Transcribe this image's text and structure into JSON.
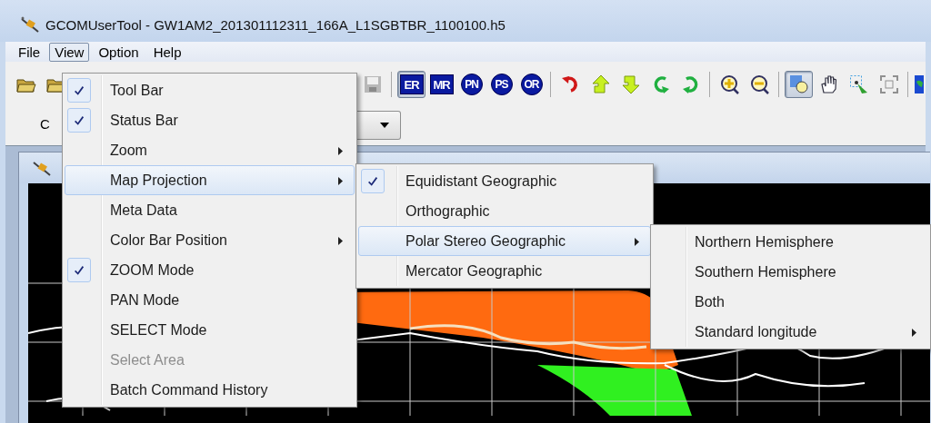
{
  "window": {
    "title": "GCOMUserTool - GW1AM2_201301112311_166A_L1SGBTBR_1100100.h5"
  },
  "menubar": [
    {
      "label": "File",
      "selected": false
    },
    {
      "label": "View",
      "selected": true
    },
    {
      "label": "Option",
      "selected": false
    },
    {
      "label": "Help",
      "selected": false
    }
  ],
  "toolbar_left": [
    {
      "kind": "open-folder",
      "pressed": false
    },
    {
      "kind": "open-folder",
      "pressed": false
    }
  ],
  "toolbar_right": [
    {
      "kind": "save",
      "pressed": false
    },
    {
      "kind": "separator"
    },
    {
      "kind": "square",
      "label": "ER",
      "pressed": true
    },
    {
      "kind": "square",
      "label": "MR",
      "pressed": false
    },
    {
      "kind": "circle",
      "label": "PN",
      "pressed": false
    },
    {
      "kind": "circle",
      "label": "PS",
      "pressed": false
    },
    {
      "kind": "circle",
      "label": "OR",
      "pressed": false
    },
    {
      "kind": "separator"
    },
    {
      "kind": "undo",
      "pressed": false
    },
    {
      "kind": "up",
      "pressed": false
    },
    {
      "kind": "down",
      "pressed": false
    },
    {
      "kind": "rotate-left",
      "pressed": false
    },
    {
      "kind": "rotate-right",
      "pressed": false
    },
    {
      "kind": "separator"
    },
    {
      "kind": "zoom-in",
      "pressed": false
    },
    {
      "kind": "zoom-out",
      "pressed": false
    },
    {
      "kind": "separator"
    },
    {
      "kind": "select",
      "pressed": true
    },
    {
      "kind": "hand",
      "pressed": false
    },
    {
      "kind": "select-area",
      "pressed": false
    },
    {
      "kind": "fit",
      "pressed": false
    },
    {
      "kind": "separator"
    },
    {
      "kind": "globe",
      "pressed": false
    }
  ],
  "combo_label": "C",
  "view_menu": [
    {
      "label": "Tool Bar",
      "checked": true,
      "submenu": false,
      "disabled": false,
      "selected": false
    },
    {
      "label": "Status Bar",
      "checked": true,
      "submenu": false,
      "disabled": false,
      "selected": false
    },
    {
      "label": "Zoom",
      "checked": false,
      "submenu": true,
      "disabled": false,
      "selected": false
    },
    {
      "label": "Map Projection",
      "checked": false,
      "submenu": true,
      "disabled": false,
      "selected": true
    },
    {
      "label": "Meta Data",
      "checked": false,
      "submenu": false,
      "disabled": false,
      "selected": false
    },
    {
      "label": "Color Bar Position",
      "checked": false,
      "submenu": true,
      "disabled": false,
      "selected": false
    },
    {
      "label": "ZOOM Mode",
      "checked": true,
      "submenu": false,
      "disabled": false,
      "selected": false
    },
    {
      "label": "PAN Mode",
      "checked": false,
      "submenu": false,
      "disabled": false,
      "selected": false
    },
    {
      "label": "SELECT Mode",
      "checked": false,
      "submenu": false,
      "disabled": false,
      "selected": false
    },
    {
      "label": "Select Area",
      "checked": false,
      "submenu": false,
      "disabled": true,
      "selected": false
    },
    {
      "label": "Batch Command History",
      "checked": false,
      "submenu": false,
      "disabled": false,
      "selected": false
    }
  ],
  "projection_menu": [
    {
      "label": "Equidistant Geographic",
      "checked": true,
      "submenu": false,
      "disabled": false,
      "selected": false
    },
    {
      "label": "Orthographic",
      "checked": false,
      "submenu": false,
      "disabled": false,
      "selected": false
    },
    {
      "label": "Polar Stereo Geographic",
      "checked": false,
      "submenu": true,
      "disabled": false,
      "selected": true
    },
    {
      "label": "Mercator Geographic",
      "checked": false,
      "submenu": false,
      "disabled": false,
      "selected": false
    }
  ],
  "polar_menu": [
    {
      "label": "Northern Hemisphere",
      "checked": false,
      "submenu": false,
      "disabled": false,
      "selected": false
    },
    {
      "label": "Southern Hemisphere",
      "checked": false,
      "submenu": false,
      "disabled": false,
      "selected": false
    },
    {
      "label": "Both",
      "checked": false,
      "submenu": false,
      "disabled": false,
      "selected": false
    },
    {
      "label": "Standard longitude",
      "checked": false,
      "submenu": true,
      "disabled": false,
      "selected": false
    }
  ]
}
